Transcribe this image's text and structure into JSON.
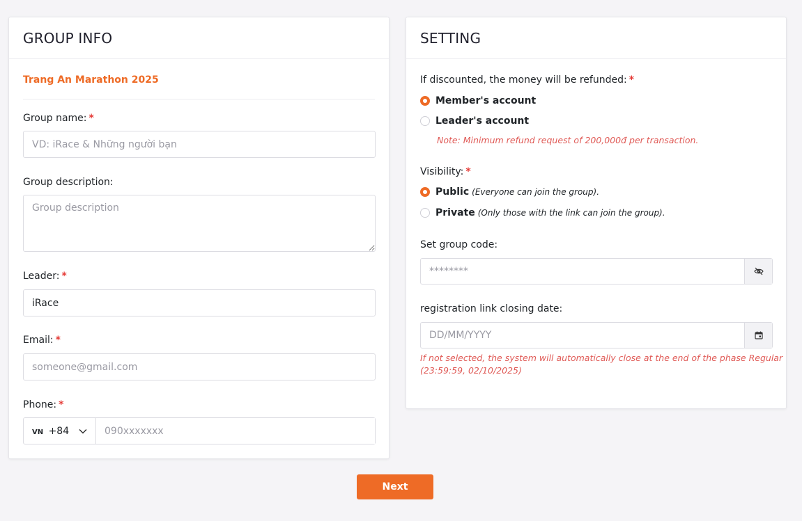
{
  "group_info": {
    "title": "GROUP INFO",
    "event_name": "Trang An Marathon 2025",
    "group_name": {
      "label": "Group name:",
      "required": "*",
      "placeholder": "VD: iRace & Những người bạn",
      "value": ""
    },
    "group_description": {
      "label": "Group description:",
      "placeholder": "Group description",
      "value": ""
    },
    "leader": {
      "label": "Leader:",
      "required": "*",
      "value": "iRace"
    },
    "email": {
      "label": "Email:",
      "required": "*",
      "placeholder": "someone@gmail.com",
      "value": ""
    },
    "phone": {
      "label": "Phone:",
      "required": "*",
      "country_flag": "VN",
      "country_code": "+84",
      "placeholder": "090xxxxxxx"
    }
  },
  "setting": {
    "title": "SETTING",
    "refund": {
      "label": "If discounted, the money will be refunded:",
      "required": "*",
      "options": [
        {
          "label": "Member's account",
          "checked": true
        },
        {
          "label": "Leader's account",
          "checked": false
        }
      ],
      "note": "Note: Minimum refund request of 200,000đ per transaction."
    },
    "visibility": {
      "label": "Visibility:",
      "required": "*",
      "options": [
        {
          "label": "Public",
          "hint": "(Everyone can join the group).",
          "checked": true
        },
        {
          "label": "Private",
          "hint": "(Only those with the link can join the group).",
          "checked": false
        }
      ]
    },
    "group_code": {
      "label": "Set group code:",
      "placeholder": "********"
    },
    "closing_date": {
      "label": "registration link closing date:",
      "placeholder": "DD/MM/YYYY",
      "note_line1": "If not selected, the system will automatically close at the end of the phase Regular",
      "note_line2": "(23:59:59, 02/10/2025)"
    }
  },
  "actions": {
    "next_label": "Next"
  },
  "colors": {
    "accent": "#ee6b26",
    "required": "#e53935",
    "note": "#e05b57",
    "background": "#f5f4f7"
  },
  "icons": {
    "code_toggle": "eye-slash-icon",
    "calendar": "calendar-icon",
    "dropdown": "chevron-down-icon"
  }
}
